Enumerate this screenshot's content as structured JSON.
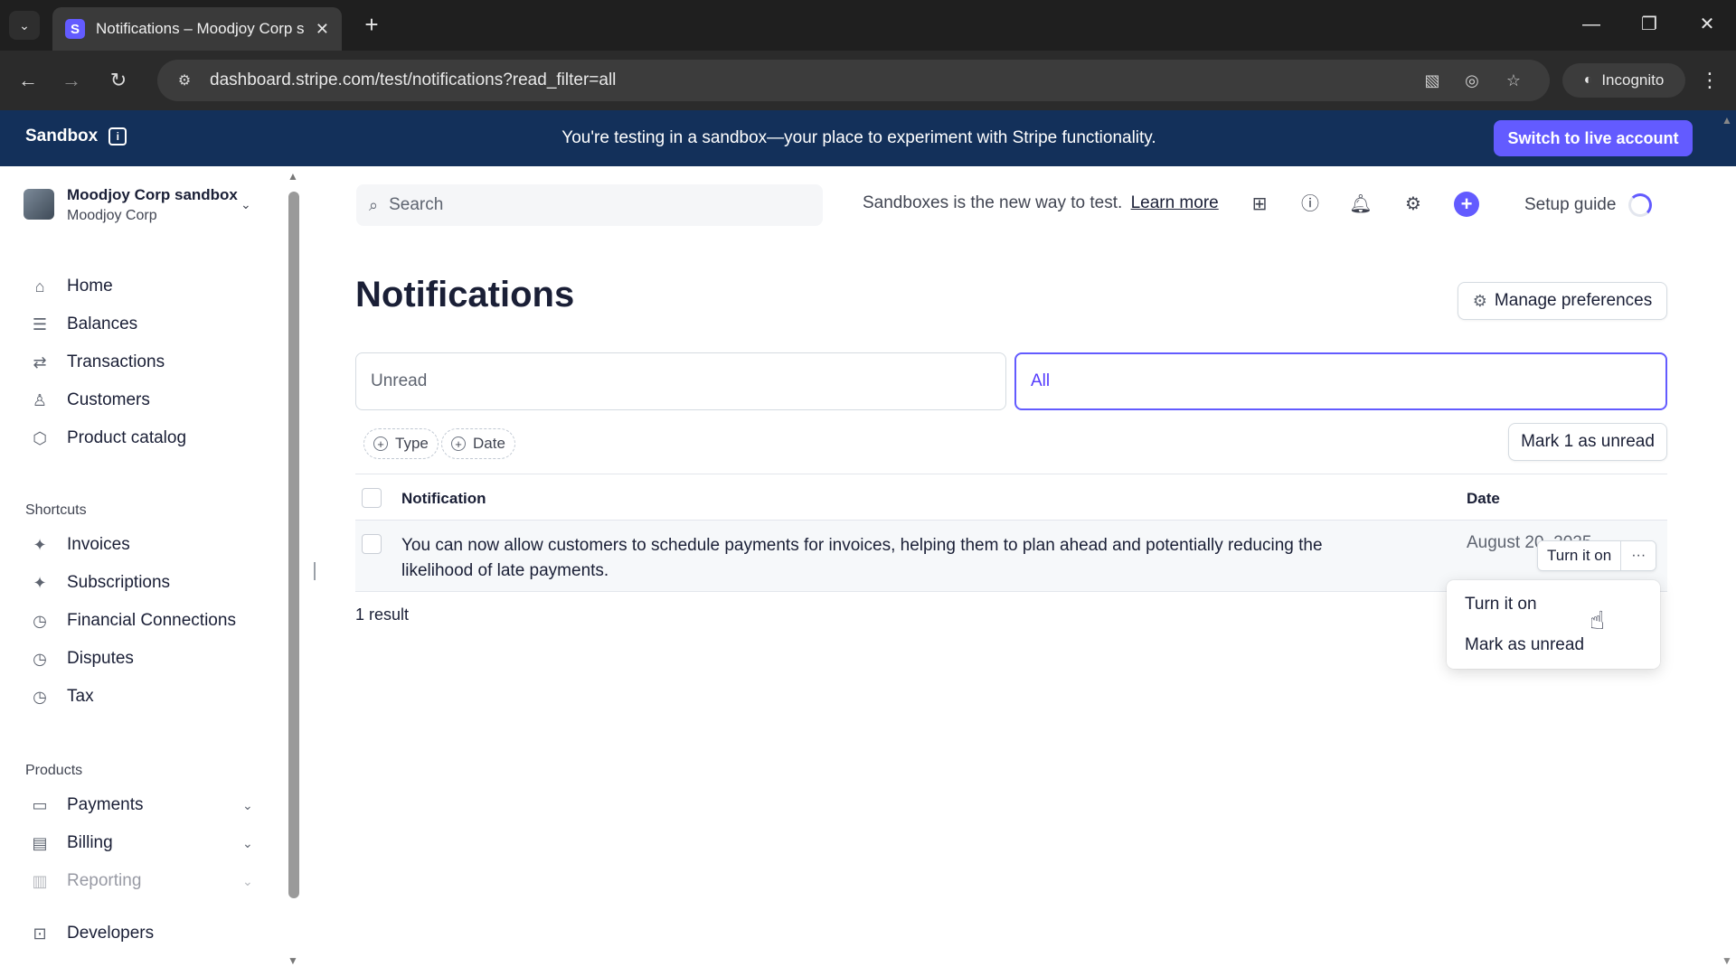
{
  "browser": {
    "tab_title": "Notifications – Moodjoy Corp s",
    "tab_icon_letter": "S",
    "url": "dashboard.stripe.com/test/notifications?read_filter=all",
    "incognito_label": "Incognito"
  },
  "banner": {
    "label": "Sandbox",
    "message": "You're testing in a sandbox—your place to experiment with Stripe functionality.",
    "switch_label": "Switch to live account"
  },
  "account": {
    "name": "Moodjoy Corp sandbox",
    "org": "Moodjoy Corp"
  },
  "sidebar": {
    "main_items": [
      {
        "label": "Home",
        "icon": "home-icon"
      },
      {
        "label": "Balances",
        "icon": "balances-icon"
      },
      {
        "label": "Transactions",
        "icon": "transactions-icon"
      },
      {
        "label": "Customers",
        "icon": "customers-icon"
      },
      {
        "label": "Product catalog",
        "icon": "product-catalog-icon"
      }
    ],
    "shortcuts_label": "Shortcuts",
    "shortcuts": [
      {
        "label": "Invoices",
        "icon": "pin-icon"
      },
      {
        "label": "Subscriptions",
        "icon": "pin-icon"
      },
      {
        "label": "Financial Connections",
        "icon": "clock-icon"
      },
      {
        "label": "Disputes",
        "icon": "clock-icon"
      },
      {
        "label": "Tax",
        "icon": "clock-icon"
      }
    ],
    "products_label": "Products",
    "products": [
      {
        "label": "Payments",
        "icon": "payments-icon"
      },
      {
        "label": "Billing",
        "icon": "billing-icon"
      },
      {
        "label": "Reporting",
        "icon": "reporting-icon"
      }
    ],
    "developers_label": "Developers"
  },
  "topbar": {
    "search_placeholder": "Search",
    "note": "Sandboxes is the new way to test.",
    "learn_more": "Learn more",
    "setup_guide": "Setup guide"
  },
  "page": {
    "title": "Notifications",
    "manage_preferences": "Manage preferences",
    "tabs": {
      "unread": "Unread",
      "all": "All"
    },
    "filters": {
      "type": "Type",
      "date": "Date"
    },
    "mark_unread_button": "Mark 1 as unread",
    "columns": {
      "notification": "Notification",
      "date": "Date"
    },
    "rows": [
      {
        "text": "You can now allow customers to schedule payments for invoices, helping them to plan ahead and potentially reducing the likelihood of late payments.",
        "date": "August 20, 2025",
        "action": "Turn it on",
        "more": "···"
      }
    ],
    "result_count": "1 result"
  },
  "menu": {
    "items": [
      "Turn it on",
      "Mark as unread"
    ]
  },
  "colors": {
    "accent": "#635bff",
    "banner": "#13305a"
  }
}
